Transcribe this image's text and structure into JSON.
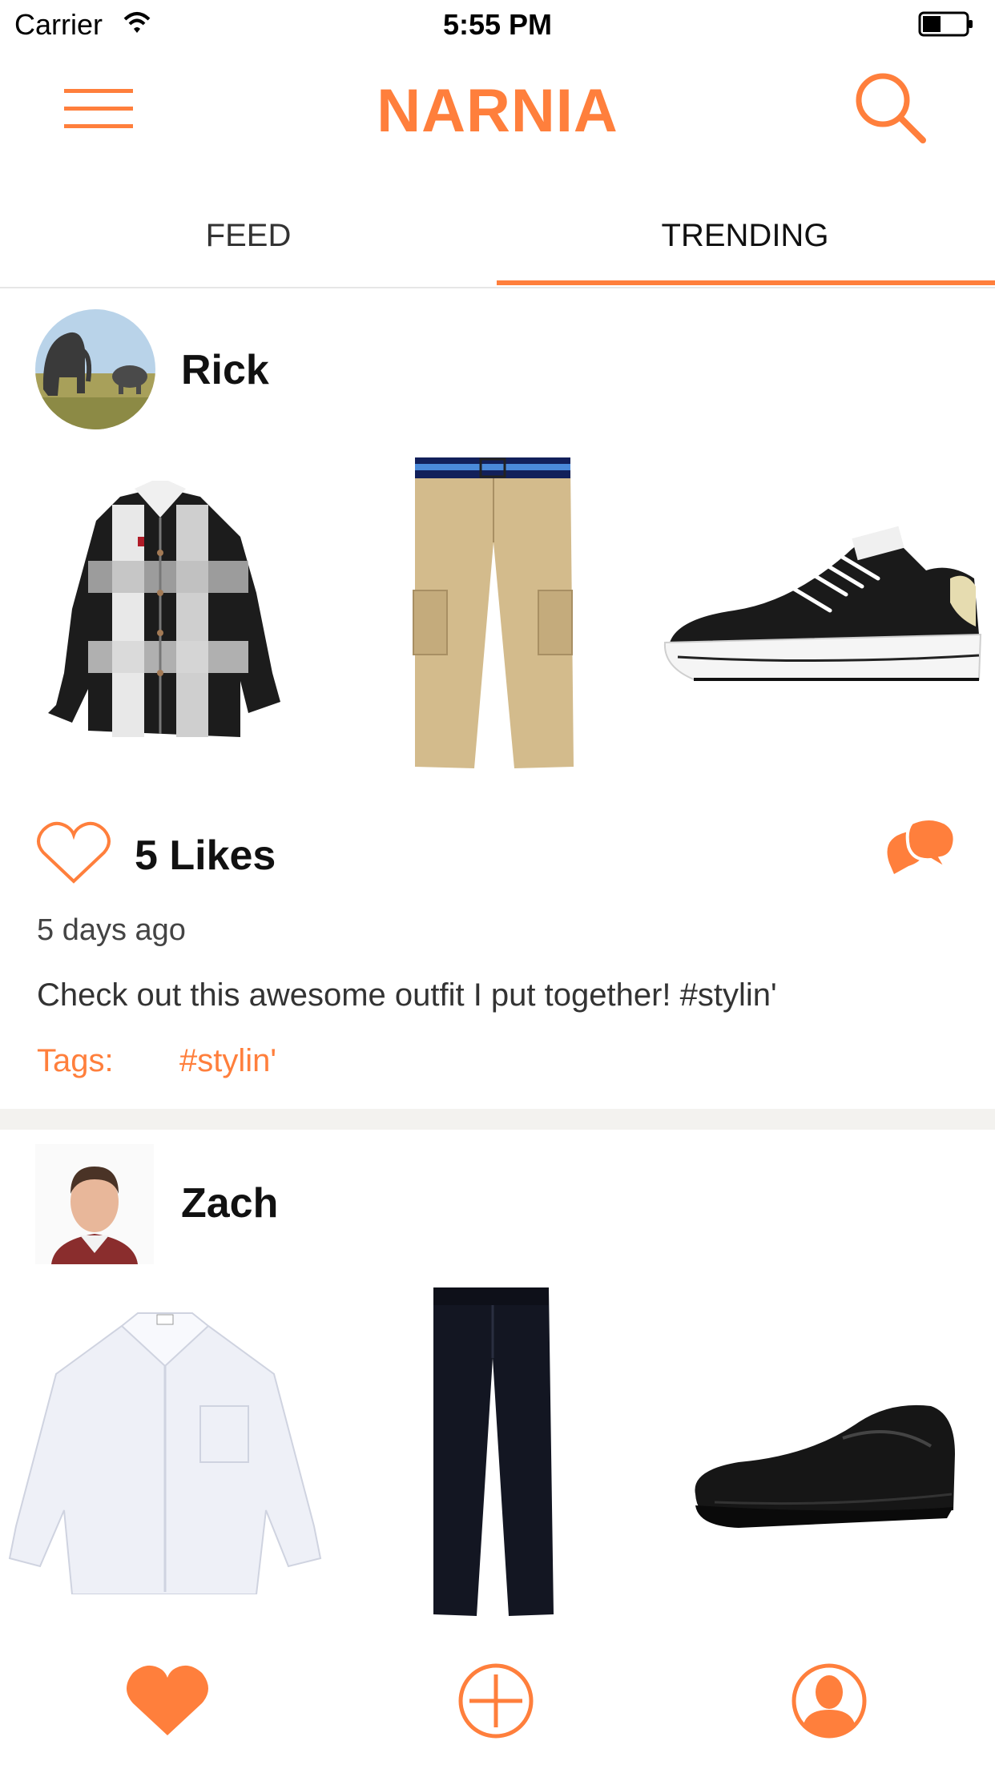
{
  "status_bar": {
    "carrier": "Carrier",
    "time": "5:55 PM"
  },
  "header": {
    "title": "NARNIA",
    "menu_icon": "hamburger-menu-icon",
    "search_icon": "search-icon"
  },
  "tabs": [
    {
      "label": "FEED",
      "selected": false
    },
    {
      "label": "TRENDING",
      "selected": true
    }
  ],
  "posts": [
    {
      "user": "Rick",
      "avatar_icon": "elephant-avatar",
      "items": [
        "plaid-shirt",
        "khaki-cargo-pants",
        "black-sneaker"
      ],
      "likes_label": "5 Likes",
      "time": "5 days ago",
      "caption": "Check out this awesome outfit I put together! #stylin'",
      "tags_label": "Tags:",
      "tags": [
        "#stylin'"
      ]
    },
    {
      "user": "Zach",
      "avatar_icon": "man-portrait-avatar",
      "items": [
        "white-dress-shirt",
        "black-pants",
        "black-loafer"
      ]
    }
  ],
  "bottom_bar": {
    "items": [
      "heart-icon",
      "add-circle-icon",
      "profile-icon"
    ]
  },
  "colors": {
    "accent": "#ff7f3c"
  }
}
